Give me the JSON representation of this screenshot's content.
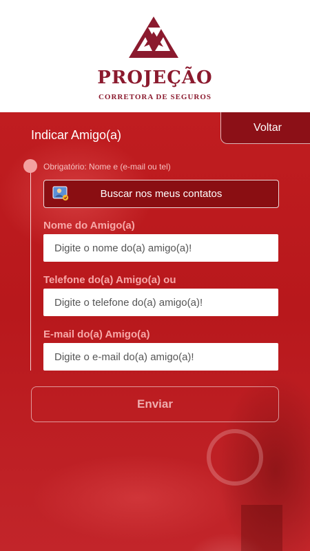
{
  "brand": {
    "name": "PROJEÇÃO",
    "tagline": "CORRETORA DE SEGUROS",
    "color": "#8b1a2e",
    "logo_icon": "projecao-triangle-logo"
  },
  "nav": {
    "back_label": "Voltar"
  },
  "form": {
    "title": "Indicar Amigo(a)",
    "required_note": "Obrigatório: Nome e (e-mail ou tel)",
    "contacts_button": {
      "label": "Buscar nos meus contatos",
      "icon": "contacts-icon"
    },
    "name_field": {
      "label": "Nome do Amigo(a)",
      "placeholder": "Digite o nome do(a) amigo(a)!",
      "value": ""
    },
    "phone_field": {
      "label": "Telefone do(a) Amigo(a) ou",
      "placeholder": "Digite o telefone do(a) amigo(a)!",
      "value": ""
    },
    "email_field": {
      "label": "E-mail do(a) Amigo(a)",
      "placeholder": "Digite o e-mail do(a) amigo(a)!",
      "value": ""
    },
    "submit_label": "Enviar"
  },
  "colors": {
    "background_red": "#c01d20",
    "button_dark_red": "#8a0e12",
    "label_pink": "#f7a8a8"
  }
}
